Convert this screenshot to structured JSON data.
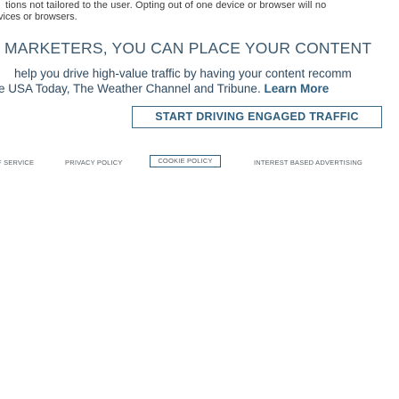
{
  "notice": {
    "line1": "tions not tailored to the user. Opting out of one device or browser will no",
    "line2": "vices or browsers."
  },
  "marketers": {
    "heading": "MARKETERS, YOU CAN PLACE YOUR CONTENT",
    "line1": "help you drive high-value traffic by having your content recomm",
    "line2_prefix": "e USA Today, The Weather Channel and Tribune. ",
    "learn_more": "Learn More"
  },
  "cta": {
    "label": "START DRIVING ENGAGED TRAFFIC"
  },
  "footer": {
    "terms": "F SERVICE",
    "privacy": "PRIVACY POLICY",
    "cookie": "COOKIE POLICY",
    "interest": "INTEREST BASED ADVERTISING"
  },
  "colors": {
    "heading": "#3d5a70",
    "accent": "#2f5f7f",
    "body_text": "#2f4960",
    "footer_text": "#555f66"
  }
}
